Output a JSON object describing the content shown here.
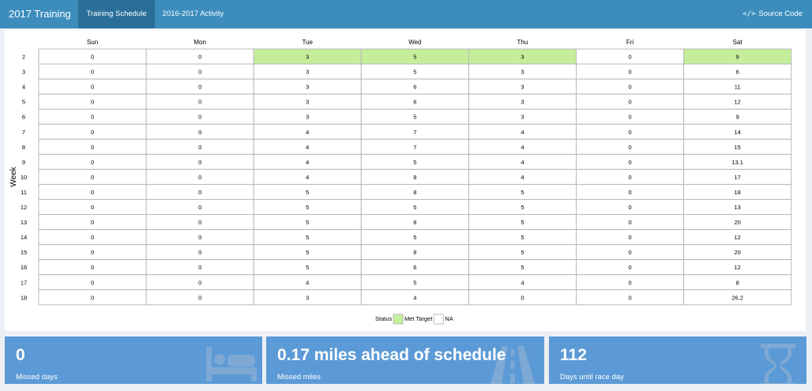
{
  "header": {
    "title": "2017 Training",
    "tabs": [
      {
        "label": "Training Schedule",
        "active": true
      },
      {
        "label": "2016-2017 Activity",
        "active": false
      }
    ],
    "source_code_label": "Source Code",
    "source_code_icon": "code-icon",
    "bar_color": "#3c8dbc",
    "active_tab_color": "#2a6f99"
  },
  "chart_data": {
    "type": "heatmap",
    "ylabel": "Week",
    "columns": [
      "Sun",
      "Mon",
      "Tue",
      "Wed",
      "Thu",
      "Fri",
      "Sat"
    ],
    "weeks": [
      "2",
      "3",
      "4",
      "5",
      "6",
      "7",
      "8",
      "9",
      "10",
      "11",
      "12",
      "13",
      "14",
      "15",
      "16",
      "17",
      "18"
    ],
    "values": [
      [
        "0",
        "0",
        "3",
        "5",
        "3",
        "0",
        "9"
      ],
      [
        "0",
        "0",
        "3",
        "5",
        "3",
        "0",
        "6"
      ],
      [
        "0",
        "0",
        "3",
        "6",
        "3",
        "0",
        "11"
      ],
      [
        "0",
        "0",
        "3",
        "6",
        "3",
        "0",
        "12"
      ],
      [
        "0",
        "0",
        "3",
        "5",
        "3",
        "0",
        "9"
      ],
      [
        "0",
        "0",
        "4",
        "7",
        "4",
        "0",
        "14"
      ],
      [
        "0",
        "0",
        "4",
        "7",
        "4",
        "0",
        "15"
      ],
      [
        "0",
        "0",
        "4",
        "5",
        "4",
        "0",
        "13.1"
      ],
      [
        "0",
        "0",
        "4",
        "8",
        "4",
        "0",
        "17"
      ],
      [
        "0",
        "0",
        "5",
        "8",
        "5",
        "0",
        "18"
      ],
      [
        "0",
        "0",
        "5",
        "5",
        "5",
        "0",
        "13"
      ],
      [
        "0",
        "0",
        "5",
        "8",
        "5",
        "0",
        "20"
      ],
      [
        "0",
        "0",
        "5",
        "5",
        "5",
        "0",
        "12"
      ],
      [
        "0",
        "0",
        "5",
        "8",
        "5",
        "0",
        "20"
      ],
      [
        "0",
        "0",
        "5",
        "6",
        "5",
        "0",
        "12"
      ],
      [
        "0",
        "0",
        "4",
        "5",
        "4",
        "0",
        "8"
      ],
      [
        "0",
        "0",
        "3",
        "4",
        "0",
        "0",
        "26.2"
      ]
    ],
    "status": [
      [
        "NA",
        "NA",
        "Met Target",
        "Met Target",
        "Met Target",
        "NA",
        "Met Target"
      ],
      [
        "NA",
        "NA",
        "NA",
        "NA",
        "NA",
        "NA",
        "NA"
      ],
      [
        "NA",
        "NA",
        "NA",
        "NA",
        "NA",
        "NA",
        "NA"
      ],
      [
        "NA",
        "NA",
        "NA",
        "NA",
        "NA",
        "NA",
        "NA"
      ],
      [
        "NA",
        "NA",
        "NA",
        "NA",
        "NA",
        "NA",
        "NA"
      ],
      [
        "NA",
        "NA",
        "NA",
        "NA",
        "NA",
        "NA",
        "NA"
      ],
      [
        "NA",
        "NA",
        "NA",
        "NA",
        "NA",
        "NA",
        "NA"
      ],
      [
        "NA",
        "NA",
        "NA",
        "NA",
        "NA",
        "NA",
        "NA"
      ],
      [
        "NA",
        "NA",
        "NA",
        "NA",
        "NA",
        "NA",
        "NA"
      ],
      [
        "NA",
        "NA",
        "NA",
        "NA",
        "NA",
        "NA",
        "NA"
      ],
      [
        "NA",
        "NA",
        "NA",
        "NA",
        "NA",
        "NA",
        "NA"
      ],
      [
        "NA",
        "NA",
        "NA",
        "NA",
        "NA",
        "NA",
        "NA"
      ],
      [
        "NA",
        "NA",
        "NA",
        "NA",
        "NA",
        "NA",
        "NA"
      ],
      [
        "NA",
        "NA",
        "NA",
        "NA",
        "NA",
        "NA",
        "NA"
      ],
      [
        "NA",
        "NA",
        "NA",
        "NA",
        "NA",
        "NA",
        "NA"
      ],
      [
        "NA",
        "NA",
        "NA",
        "NA",
        "NA",
        "NA",
        "NA"
      ],
      [
        "NA",
        "NA",
        "NA",
        "NA",
        "NA",
        "NA",
        "NA"
      ]
    ],
    "legend": {
      "title": "Status",
      "placement": "bottom-center",
      "items": [
        {
          "label": "Met Target",
          "color": "#c5ee9b"
        },
        {
          "label": "NA",
          "color": "#ffffff"
        }
      ]
    },
    "grid": true
  },
  "value_boxes": [
    {
      "value": "0",
      "caption": "Missed days",
      "icon": "bed-icon",
      "color": "#5b9ad6"
    },
    {
      "value": "0.17 miles ahead of schedule",
      "caption": "Missed miles",
      "icon": "road-icon",
      "color": "#5b9ad6"
    },
    {
      "value": "112",
      "caption": "Days until race day",
      "icon": "hourglass-icon",
      "color": "#5b9ad6"
    }
  ]
}
